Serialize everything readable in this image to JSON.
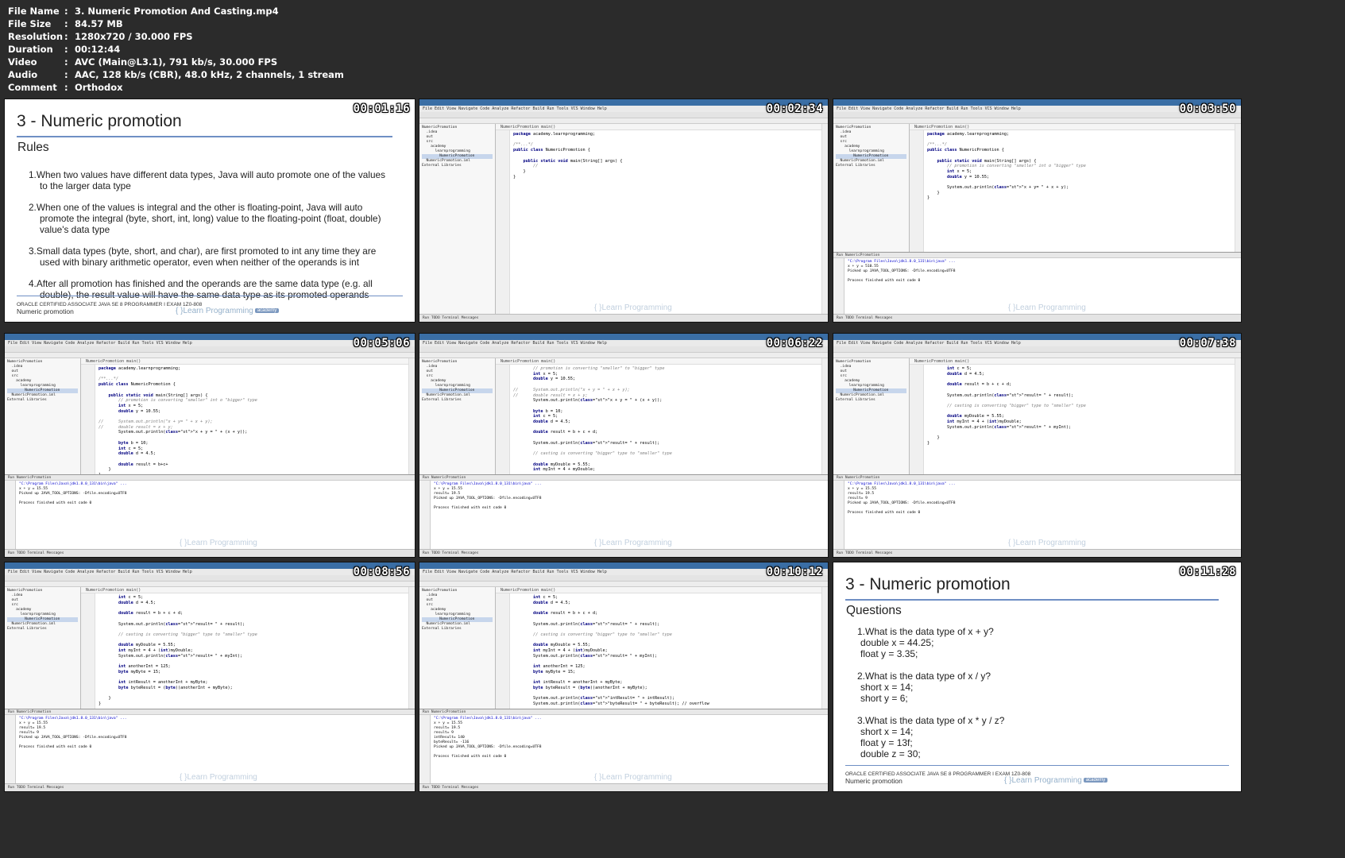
{
  "file_info": [
    {
      "key": "File Name",
      "sep": ":",
      "value": "3. Numeric Promotion And Casting.mp4"
    },
    {
      "key": "File Size",
      "sep": ":",
      "value": "84.57 MB"
    },
    {
      "key": "Resolution",
      "sep": ":",
      "value": "1280x720 / 30.000 FPS"
    },
    {
      "key": "Duration",
      "sep": ":",
      "value": "00:12:44"
    },
    {
      "key": "Video",
      "sep": ":",
      "value": "AVC (Main@L3.1), 791 kb/s, 30.000 FPS"
    },
    {
      "key": "Audio",
      "sep": ":",
      "value": "AAC, 128 kb/s (CBR), 48.0 kHz, 2 channels, 1 stream"
    },
    {
      "key": "Comment",
      "sep": ":",
      "value": "Orthodox"
    }
  ],
  "thumbs": [
    {
      "timestamp": "00:01:16",
      "kind": "slide",
      "title": "3 - Numeric promotion",
      "subtitle": "Rules",
      "rules": [
        "1.When two values have different data types, Java will auto promote one of the values to the larger data type",
        "2.When one of the values is integral and the other is floating-point, Java will auto promote the integral (byte, short, int, long) value to the floating-point (float, double) value's data type",
        "3.Small data types (byte, short, and char), are first promoted to int any time they are used with binary arithmetic operator, even when neither of the operands is int",
        "4.After all promotion has finished and the operands are the same data type (e.g. all double), the result value will have the same data type as its promoted operands"
      ],
      "footer_line1": "ORACLE CERTIFIED ASSOCIATE JAVA SE 8 PROGRAMMER I EXAM 1Z0-808",
      "footer_line2": "Numeric promotion",
      "logo": "{ }Learn Programming",
      "logo_badge": "academy"
    },
    {
      "timestamp": "00:02:34",
      "kind": "ide",
      "crumb": "NumericPromotion  main()",
      "code": [
        "package academy.learnprogramming;",
        "",
        "/**...*/",
        "public class NumericPromotion {",
        "",
        "    public static void main(String[] args) {",
        "        //",
        "    }",
        "}"
      ]
    },
    {
      "timestamp": "00:03:50",
      "kind": "ide",
      "crumb": "NumericPromotion  main()",
      "code": [
        "package academy.learnprogramming;",
        "",
        "/**...*/",
        "public class NumericPromotion {",
        "",
        "    public static void main(String[] args) {",
        "        // promotion is converting \"smaller\" int o \"bigger\" type",
        "        int x = 5;",
        "        double y = 10.55;",
        "",
        "        System.out.println(\"x + y= \" + x + y);",
        "    }",
        "}"
      ],
      "output": [
        "\"C:\\Program Files\\Java\\jdk1.8.0_131\\bin\\java\" ...",
        "x + y = 510.55",
        "Picked up JAVA_TOOL_OPTIONS: -Dfile.encoding=UTF8",
        "",
        "Process finished with exit code 0"
      ]
    },
    {
      "timestamp": "00:05:06",
      "kind": "ide",
      "crumb": "NumericPromotion  main()",
      "code": [
        "package academy.learnprogramming;",
        "",
        "/**...*/",
        "public class NumericPromotion {",
        "",
        "    public static void main(String[] args) {",
        "        // promotion is converting \"smaller\" int o \"bigger\" type",
        "        int x = 5;",
        "        double y = 10.55;",
        "",
        "//      System.out.println(\"x + y= \" + x + y);",
        "//      double result = x + y;",
        "        System.out.println(\"x + y = \" + (x + y));",
        "",
        "        byte b = 10;",
        "        int c = 5;",
        "        double d = 4.5;",
        "",
        "        double result = b+c+",
        "    }",
        "}"
      ],
      "output": [
        "\"C:\\Program Files\\Java\\jdk1.8.0_131\\bin\\java\" ...",
        "x + y = 15.55",
        "Picked up JAVA_TOOL_OPTIONS: -Dfile.encoding=UTF8",
        "",
        "Process finished with exit code 0"
      ]
    },
    {
      "timestamp": "00:06:22",
      "kind": "ide",
      "crumb": "NumericPromotion  main()",
      "code": [
        "        // promotion is converting \"smaller\" to \"bigger\" type",
        "        int x = 5;",
        "        double y = 10.55;",
        "",
        "//      System.out.println(\"x + y = \" + x + y);",
        "//      double result = x + y;",
        "        System.out.println(\"x + y = \" + (x + y));",
        "",
        "        byte b = 10;",
        "        int c = 5;",
        "        double d = 4.5;",
        "",
        "        double result = b + c + d;",
        "",
        "        System.out.println(\"result= \" + result);",
        "",
        "        // casting is converting \"bigger\" type to \"smaller\" type",
        "",
        "        double myDouble = 5.55;",
        "        int myInt = 4 + myDouble;"
      ],
      "output": [
        "\"C:\\Program Files\\Java\\jdk1.8.0_131\\bin\\java\" ...",
        "x + y = 15.55",
        "result= 19.5",
        "Picked up JAVA_TOOL_OPTIONS: -Dfile.encoding=UTF8",
        "",
        "Process finished with exit code 0"
      ]
    },
    {
      "timestamp": "00:07:38",
      "kind": "ide",
      "crumb": "NumericPromotion  main()",
      "code": [
        "        int c = 5;",
        "        double d = 4.5;",
        "",
        "        double result = b + c + d;",
        "",
        "        System.out.println(\"result= \" + result);",
        "",
        "        // casting is converting \"bigger\" type to \"smaller\" type",
        "",
        "        double myDouble = 5.55;",
        "        int myInt = 4 + (int)myDouble;",
        "        System.out.println(\"result= \" + myInt);",
        "",
        "    }",
        "}"
      ],
      "output": [
        "\"C:\\Program Files\\Java\\jdk1.8.0_131\\bin\\java\" ...",
        "x + y = 15.55",
        "result= 19.5",
        "result= 9",
        "Picked up JAVA_TOOL_OPTIONS: -Dfile.encoding=UTF8",
        "",
        "Process finished with exit code 0"
      ]
    },
    {
      "timestamp": "00:08:56",
      "kind": "ide",
      "crumb": "NumericPromotion  main()",
      "code": [
        "        int c = 5;",
        "        double d = 4.5;",
        "",
        "        double result = b + c + d;",
        "",
        "        System.out.println(\"result= \" + result);",
        "",
        "        // casting is converting \"bigger\" type to \"smaller\" type",
        "",
        "        double myDouble = 5.55;",
        "        int myInt = 4 + (int)myDouble;",
        "        System.out.println(\"result= \" + myInt);",
        "",
        "        int anotherInt = 125;",
        "        byte myByte = 15;",
        "",
        "        int intResult = anotherInt + myByte;",
        "        byte byteResult = (byte)(anotherInt + myByte);",
        "",
        "    }",
        "}"
      ],
      "output": [
        "\"C:\\Program Files\\Java\\jdk1.8.0_131\\bin\\java\" ...",
        "x + y = 15.55",
        "result= 19.5",
        "result= 9",
        "Picked up JAVA_TOOL_OPTIONS: -Dfile.encoding=UTF8",
        "",
        "Process finished with exit code 0"
      ]
    },
    {
      "timestamp": "00:10:12",
      "kind": "ide",
      "crumb": "NumericPromotion  main()",
      "code": [
        "        int c = 5;",
        "        double d = 4.5;",
        "",
        "        double result = b + c + d;",
        "",
        "        System.out.println(\"result= \" + result);",
        "",
        "        // casting is converting \"bigger\" type to \"smaller\" type",
        "",
        "        double myDouble = 5.55;",
        "        int myInt = 4 + (int)myDouble;",
        "        System.out.println(\"result= \" + myInt);",
        "",
        "        int anotherInt = 125;",
        "        byte myByte = 15;",
        "",
        "        int intResult = anotherInt + myByte;",
        "        byte byteResult = (byte)(anotherInt + myByte);",
        "",
        "        System.out.println(\"intResult= \" + intResult);",
        "        System.out.println(\"byteResult= \" + byteResult); // overflow"
      ],
      "output": [
        "\"C:\\Program Files\\Java\\jdk1.8.0_131\\bin\\java\" ...",
        "x + y = 15.55",
        "result= 19.5",
        "result= 9",
        "intResult= 140",
        "byteResult= -116",
        "Picked up JAVA_TOOL_OPTIONS: -Dfile.encoding=UTF8",
        "",
        "Process finished with exit code 0"
      ]
    },
    {
      "timestamp": "00:11:28",
      "kind": "slide",
      "title": "3 - Numeric promotion",
      "subtitle": "Questions",
      "questions": [
        {
          "q": "1.What is the data type of x + y?",
          "lines": [
            "double x = 44.25;",
            "float y = 3.35;"
          ]
        },
        {
          "q": "2.What is the data type of x / y?",
          "lines": [
            "short x = 14;",
            "short y = 6;"
          ]
        },
        {
          "q": "3.What is the data type of x * y / z?",
          "lines": [
            "short x = 14;",
            "float y = 13f;",
            "double z = 30;"
          ]
        }
      ],
      "footer_line1": "ORACLE CERTIFIED ASSOCIATE JAVA SE 8 PROGRAMMER I EXAM 1Z0-808",
      "footer_line2": "Numeric promotion",
      "logo": "{ }Learn Programming",
      "logo_badge": "academy"
    }
  ],
  "ide_common": {
    "menu": "File  Edit  View  Navigate  Code  Analyze  Refactor  Build  Run  Tools  VCS  Window  Help",
    "project_tree": [
      "NumericPromotion",
      "  .idea",
      "  out",
      "  src",
      "    academy",
      "      learnprogramming",
      "        NumericPromotion",
      "  NumericPromotion.iml",
      "External Libraries"
    ],
    "run_tab": "Run  NumericPromotion",
    "status": "Run   TODO   Terminal   Messages",
    "watermark": "{ }Learn Programming"
  }
}
